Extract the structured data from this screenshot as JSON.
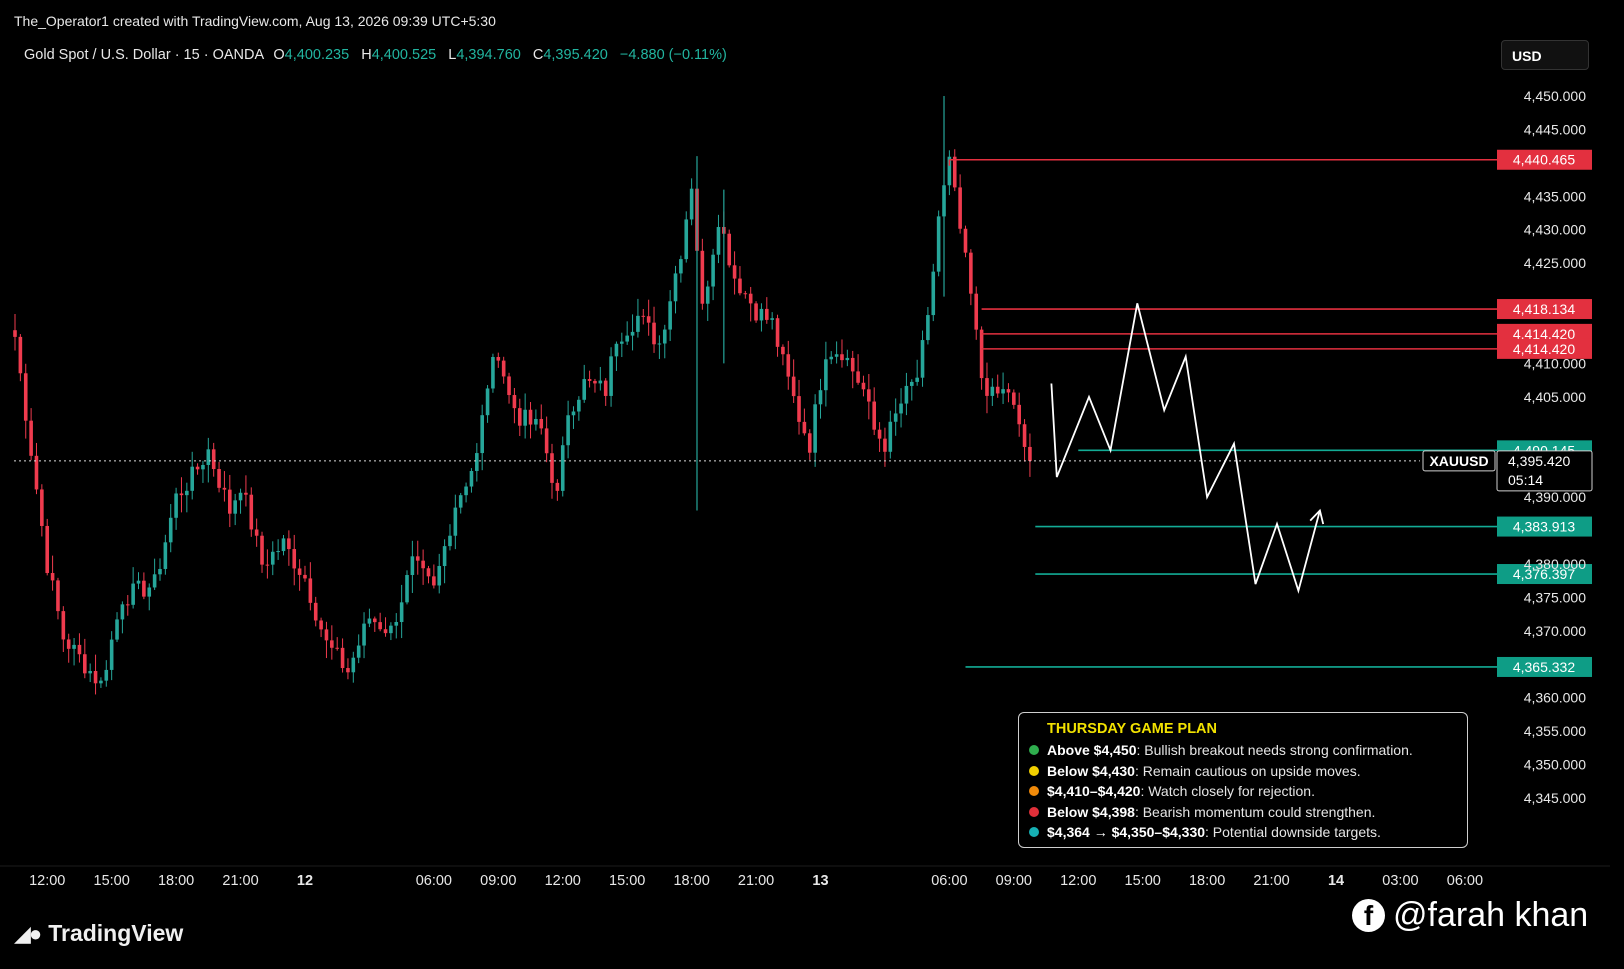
{
  "header": {
    "created_by": "The_Operator1 created with TradingView.com, Aug 13, 2026 09:39 UTC+5:30"
  },
  "symbol_bar": {
    "name": "Gold Spot / U.S. Dollar · 15 · OANDA",
    "o_label": "O",
    "o_value": "4,400.235",
    "h_label": "H",
    "h_value": "4,400.525",
    "l_label": "L",
    "l_value": "4,394.760",
    "c_label": "C",
    "c_value": "4,395.420",
    "change": "−4.880 (−0.11%)"
  },
  "currency_button": "USD",
  "brand": "TradingView",
  "watermark": "@farah khan",
  "plan": {
    "title": "THURSDAY GAME PLAN",
    "items": [
      {
        "color": "#2fae4e",
        "key": "Above $4,450",
        "text": ": Bullish breakout needs strong confirmation."
      },
      {
        "color": "#f2d000",
        "key": "Below $4,430",
        "text": ": Remain cautious on upside moves."
      },
      {
        "color": "#f08a0a",
        "key": "$4,410–$4,420",
        "text": ": Watch closely for rejection."
      },
      {
        "color": "#e0303a",
        "key": "Below $4,398",
        "text": ": Bearish momentum could strengthen."
      },
      {
        "color": "#16b0b4",
        "key": "$4,364 → $4,350–$4,330",
        "text": ": Potential downside targets."
      }
    ]
  },
  "colors": {
    "up": "#26a69a",
    "down": "#ef3b4e",
    "resistance": "#e3303f",
    "support": "#13ab95",
    "projection": "#ffffff",
    "background": "#000000"
  },
  "chart_data": {
    "type": "candlestick",
    "symbol": "XAUUSD",
    "interval": "15",
    "ylim": [
      4341,
      4458
    ],
    "y_ticks": [
      "4,450.000",
      "4,445.000",
      "4,435.000",
      "4,430.000",
      "4,425.000",
      "4,410.000",
      "4,405.000",
      "4,390.000",
      "4,380.000",
      "4,375.000",
      "4,370.000",
      "4,360.000",
      "4,355.000",
      "4,350.000",
      "4,345.000"
    ],
    "x_ticks": [
      {
        "label": "12:00",
        "i": 6
      },
      {
        "label": "15:00",
        "i": 18
      },
      {
        "label": "18:00",
        "i": 30
      },
      {
        "label": "21:00",
        "i": 42
      },
      {
        "label": "12",
        "i": 54,
        "bold": true
      },
      {
        "label": "06:00",
        "i": 78
      },
      {
        "label": "09:00",
        "i": 90
      },
      {
        "label": "12:00",
        "i": 102
      },
      {
        "label": "15:00",
        "i": 114
      },
      {
        "label": "18:00",
        "i": 126
      },
      {
        "label": "21:00",
        "i": 138
      },
      {
        "label": "13",
        "i": 150,
        "bold": true
      },
      {
        "label": "06:00",
        "i": 174
      },
      {
        "label": "09:00",
        "i": 186
      },
      {
        "label": "12:00",
        "i": 198
      },
      {
        "label": "15:00",
        "i": 210
      },
      {
        "label": "18:00",
        "i": 222
      },
      {
        "label": "21:00",
        "i": 234
      },
      {
        "label": "14",
        "i": 246,
        "bold": true
      },
      {
        "label": "03:00",
        "i": 258
      },
      {
        "label": "06:00",
        "i": 270
      }
    ],
    "anchors": [
      [
        0,
        4414
      ],
      [
        6,
        4380
      ],
      [
        9,
        4369
      ],
      [
        16,
        4362
      ],
      [
        20,
        4375
      ],
      [
        26,
        4377
      ],
      [
        30,
        4390
      ],
      [
        33,
        4393
      ],
      [
        36,
        4397
      ],
      [
        40,
        4388
      ],
      [
        42,
        4392
      ],
      [
        46,
        4380
      ],
      [
        50,
        4383
      ],
      [
        54,
        4378
      ],
      [
        58,
        4368
      ],
      [
        62,
        4364
      ],
      [
        66,
        4372
      ],
      [
        70,
        4370
      ],
      [
        74,
        4380
      ],
      [
        78,
        4376
      ],
      [
        82,
        4389
      ],
      [
        86,
        4396
      ],
      [
        88,
        4407
      ],
      [
        90,
        4412
      ],
      [
        92,
        4405
      ],
      [
        94,
        4402
      ],
      [
        98,
        4400
      ],
      [
        101,
        4390
      ],
      [
        103,
        4403
      ],
      [
        106,
        4407
      ],
      [
        110,
        4406
      ],
      [
        112,
        4414
      ],
      [
        116,
        4417
      ],
      [
        120,
        4413
      ],
      [
        124,
        4427
      ],
      [
        126,
        4437
      ],
      [
        128,
        4418
      ],
      [
        131,
        4432
      ],
      [
        134,
        4423
      ],
      [
        138,
        4418
      ],
      [
        141,
        4416
      ],
      [
        143,
        4410
      ],
      [
        146,
        4402
      ],
      [
        148,
        4398
      ],
      [
        151,
        4412
      ],
      [
        154,
        4412
      ],
      [
        158,
        4406
      ],
      [
        160,
        4400
      ],
      [
        162,
        4398
      ],
      [
        165,
        4404
      ],
      [
        168,
        4408
      ],
      [
        170,
        4416
      ],
      [
        172,
        4432
      ],
      [
        174,
        4440
      ],
      [
        176,
        4430
      ],
      [
        178,
        4420
      ],
      [
        180,
        4408
      ],
      [
        182,
        4405
      ],
      [
        185,
        4406
      ],
      [
        187,
        4400
      ],
      [
        189,
        4395
      ]
    ],
    "spikes": [
      [
        127,
        4441,
        4388
      ],
      [
        173,
        4450,
        4420
      ],
      [
        132,
        4436,
        4410
      ]
    ],
    "last_price": 4395.42,
    "last_label": "4,395.420",
    "last_countdown": "05:14",
    "resistance_levels": [
      {
        "value": 4440.465,
        "label": "4,440.465",
        "from_i": 174
      },
      {
        "value": 4418.134,
        "label": "4,418.134",
        "from_i": 180
      },
      {
        "value": 4414.42,
        "label": "4,414.420",
        "from_i": 180
      },
      {
        "value": 4414.42,
        "label": "4,414.420",
        "from_i": 180,
        "shift": 15
      }
    ],
    "support_levels": [
      {
        "value": 4397.0,
        "label": "4,490.145",
        "from_i": 198
      },
      {
        "value": 4385.6,
        "label": "4,383.913",
        "from_i": 190
      },
      {
        "value": 4378.5,
        "label": "4,376.397",
        "from_i": 190
      },
      {
        "value": 4364.6,
        "label": "4,365.332",
        "from_i": 177
      }
    ],
    "projection_path": [
      [
        193,
        4407
      ],
      [
        194,
        4393
      ],
      [
        200,
        4405
      ],
      [
        204,
        4397
      ],
      [
        209,
        4419
      ],
      [
        214,
        4403
      ],
      [
        218,
        4411
      ],
      [
        222,
        4390
      ],
      [
        227,
        4398
      ],
      [
        231,
        4377
      ],
      [
        235,
        4386
      ],
      [
        239,
        4376
      ],
      [
        243,
        4388
      ]
    ]
  }
}
